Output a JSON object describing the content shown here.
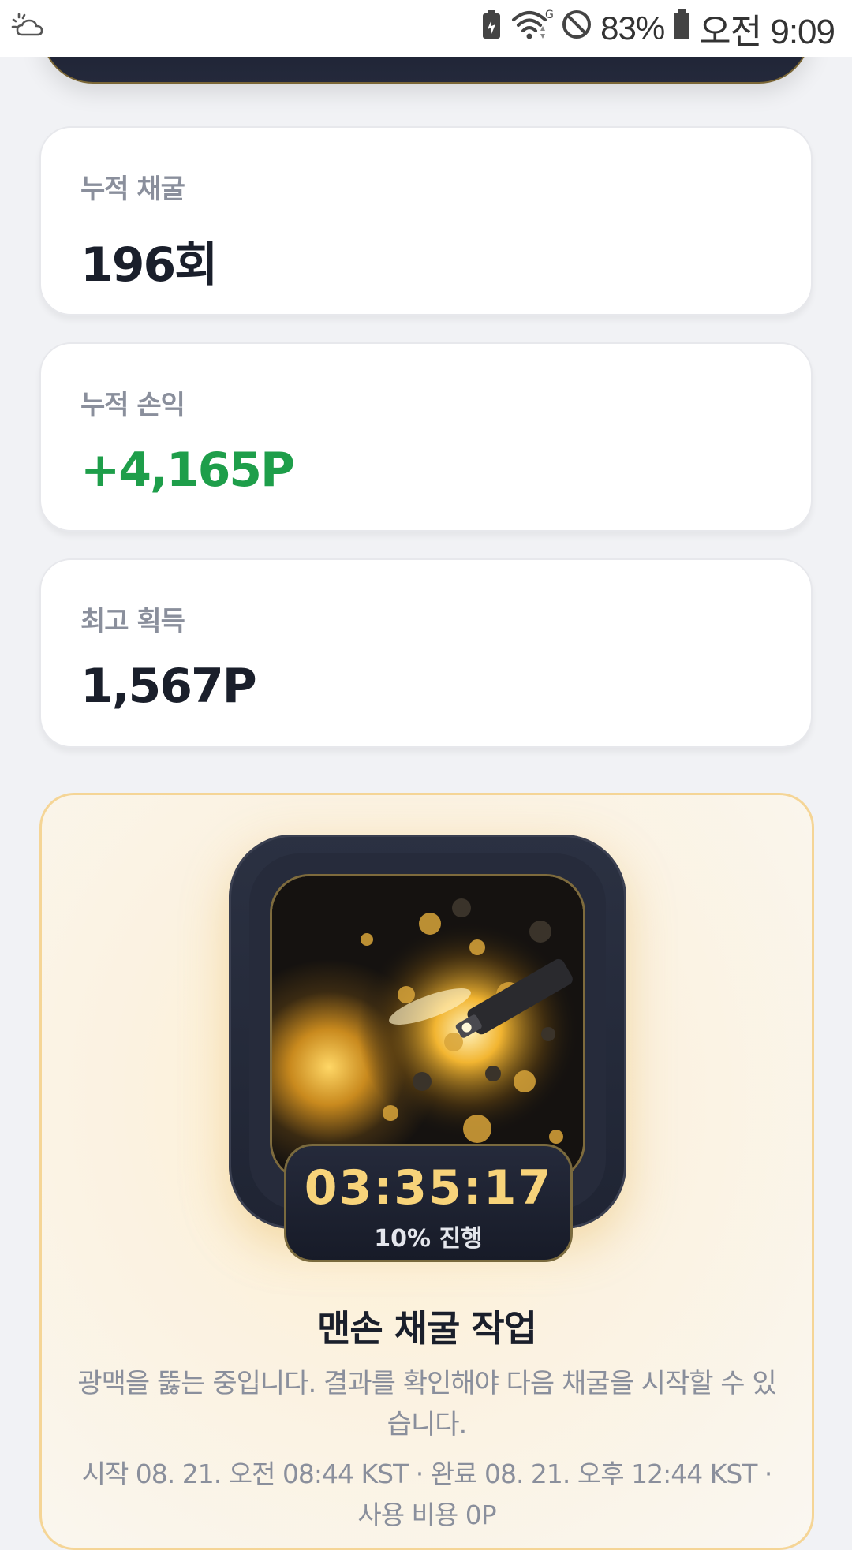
{
  "status_bar": {
    "left_icon": "weather-cloud-sun-icon",
    "battery_percent": "83%",
    "time": "오전 9:09",
    "icons": [
      "battery-saver-icon",
      "wifi-icon",
      "do-not-disturb-icon",
      "battery-icon"
    ]
  },
  "stats": [
    {
      "label": "누적 채굴",
      "value": "196회"
    },
    {
      "label": "누적 손익",
      "value": "+4,165P",
      "value_color": "#1e9e4a"
    },
    {
      "label": "최고 획득",
      "value": "1,567P"
    }
  ],
  "mining": {
    "image": "gold-mine-drill-illustration",
    "timer": "03:35:17",
    "progress_text": "10% 진행",
    "progress_percent": 10,
    "title": "맨손 채굴 작업",
    "description": "광맥을 뚫는 중입니다. 결과를 확인해야 다음 채굴을 시작할 수 있습니다.",
    "meta": "시작 08. 21. 오전 08:44 KST · 완료 08. 21. 오후 12:44 KST · 사용 비용 0P"
  },
  "colors": {
    "accent_gold": "#f7d37a",
    "positive_green": "#1e9e4a",
    "card_border_gold": "#f5d596",
    "dark_navy": "#1d2233"
  }
}
